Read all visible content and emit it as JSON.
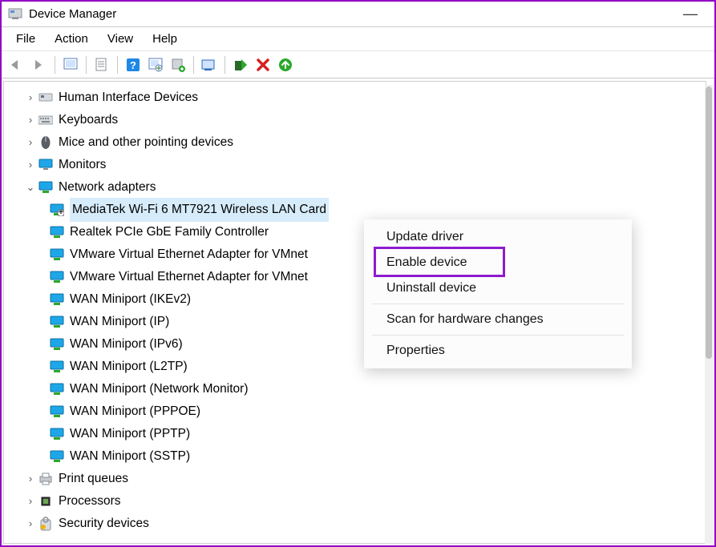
{
  "window": {
    "title": "Device Manager",
    "minimize": "—"
  },
  "menu": {
    "file": "File",
    "action": "Action",
    "view": "View",
    "help": "Help"
  },
  "toolbar_icons": {
    "back": "back-arrow",
    "forward": "forward-arrow",
    "showhide": "show-hidden",
    "properties": "properties-sheet",
    "help": "help",
    "refresh": "refresh",
    "add": "add-hardware",
    "remote": "remote-computer",
    "enable": "enable",
    "remove": "remove",
    "update": "update"
  },
  "tree": {
    "items": [
      {
        "label": "Human Interface Devices",
        "icon": "hid",
        "expanded": false
      },
      {
        "label": "Keyboards",
        "icon": "keyboard",
        "expanded": false
      },
      {
        "label": "Mice and other pointing devices",
        "icon": "mouse",
        "expanded": false
      },
      {
        "label": "Monitors",
        "icon": "monitor",
        "expanded": false
      },
      {
        "label": "Network adapters",
        "icon": "network",
        "expanded": true,
        "children": [
          {
            "label": "MediaTek Wi-Fi 6 MT7921 Wireless LAN Card",
            "icon": "network-disabled",
            "selected": true
          },
          {
            "label": "Realtek PCIe GbE Family Controller",
            "icon": "network"
          },
          {
            "label": "VMware Virtual Ethernet Adapter for VMnet",
            "icon": "network"
          },
          {
            "label": "VMware Virtual Ethernet Adapter for VMnet",
            "icon": "network"
          },
          {
            "label": "WAN Miniport (IKEv2)",
            "icon": "network"
          },
          {
            "label": "WAN Miniport (IP)",
            "icon": "network"
          },
          {
            "label": "WAN Miniport (IPv6)",
            "icon": "network"
          },
          {
            "label": "WAN Miniport (L2TP)",
            "icon": "network"
          },
          {
            "label": "WAN Miniport (Network Monitor)",
            "icon": "network"
          },
          {
            "label": "WAN Miniport (PPPOE)",
            "icon": "network"
          },
          {
            "label": "WAN Miniport (PPTP)",
            "icon": "network"
          },
          {
            "label": "WAN Miniport (SSTP)",
            "icon": "network"
          }
        ]
      },
      {
        "label": "Print queues",
        "icon": "printer",
        "expanded": false
      },
      {
        "label": "Processors",
        "icon": "cpu",
        "expanded": false
      },
      {
        "label": "Security devices",
        "icon": "security",
        "expanded": false
      }
    ]
  },
  "context_menu": {
    "items": [
      "Update driver",
      "Enable device",
      "Uninstall device",
      "Scan for hardware changes",
      "Properties"
    ],
    "highlighted_index": 1
  }
}
